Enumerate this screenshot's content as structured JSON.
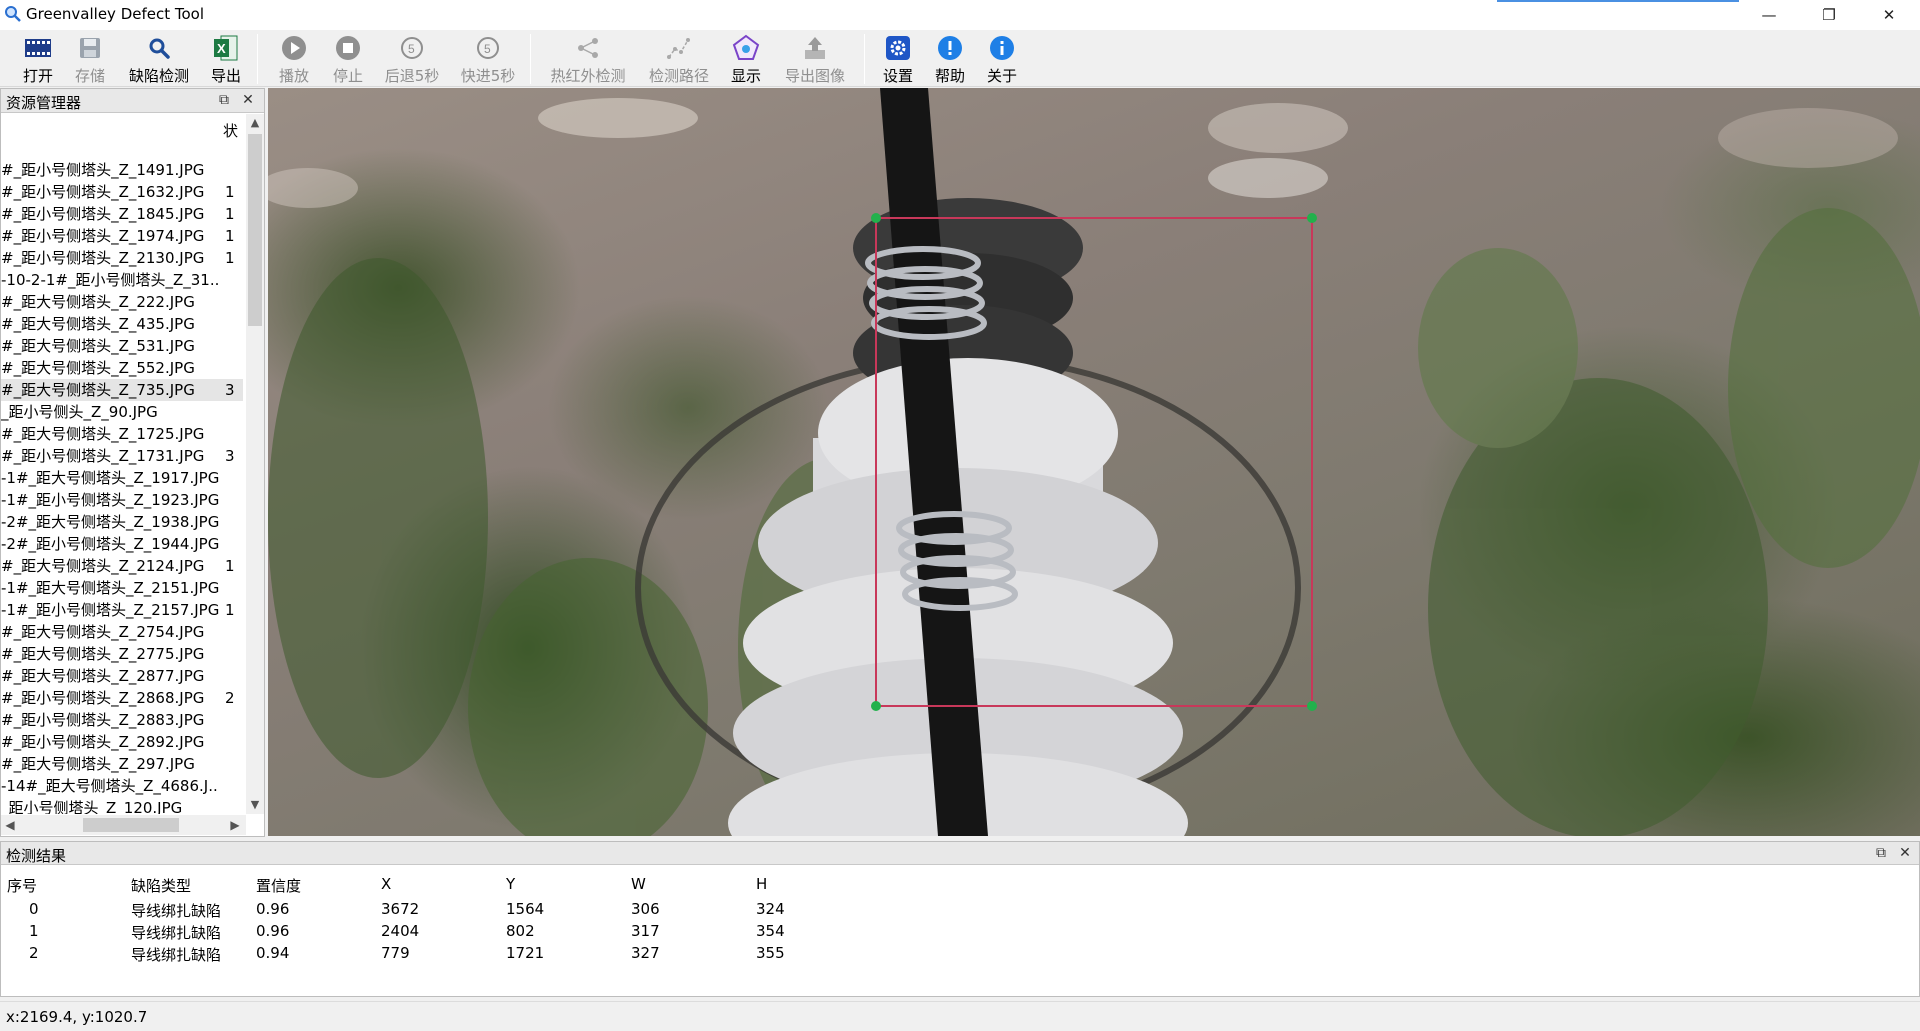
{
  "window": {
    "title": "Greenvalley Defect Tool",
    "minimize": "—",
    "restore": "❐",
    "close": "✕",
    "accent_color": "#4a90e2"
  },
  "toolbar": {
    "open": "打开",
    "save": "存储",
    "detect": "缺陷检测",
    "export": "导出",
    "play": "播放",
    "stop": "停止",
    "back5": "后退5秒",
    "fwd5": "快进5秒",
    "step_number": "5",
    "thermal": "热红外检测",
    "path": "检测路径",
    "display": "显示",
    "export_image": "导出图像",
    "settings": "设置",
    "help": "帮助",
    "about": "关于"
  },
  "explorer": {
    "title": "资源管理器",
    "status_column": "状",
    "files": [
      {
        "name": "#_距小号侧塔头_Z_1491.JPG",
        "status": ""
      },
      {
        "name": "#_距小号侧塔头_Z_1632.JPG",
        "status": "1"
      },
      {
        "name": "#_距小号侧塔头_Z_1845.JPG",
        "status": "1"
      },
      {
        "name": "#_距小号侧塔头_Z_1974.JPG",
        "status": "1"
      },
      {
        "name": "#_距小号侧塔头_Z_2130.JPG",
        "status": "1"
      },
      {
        "name": "-10-2-1#_距小号侧塔头_Z_31...",
        "status": ""
      },
      {
        "name": "#_距大号侧塔头_Z_222.JPG",
        "status": ""
      },
      {
        "name": "#_距大号侧塔头_Z_435.JPG",
        "status": ""
      },
      {
        "name": "#_距大号侧塔头_Z_531.JPG",
        "status": ""
      },
      {
        "name": "#_距大号侧塔头_Z_552.JPG",
        "status": ""
      },
      {
        "name": "#_距大号侧塔头_Z_735.JPG",
        "status": "3",
        "selected": true
      },
      {
        "name": "_距小号侧头_Z_90.JPG",
        "status": ""
      },
      {
        "name": "#_距大号侧塔头_Z_1725.JPG",
        "status": ""
      },
      {
        "name": "#_距小号侧塔头_Z_1731.JPG",
        "status": "3"
      },
      {
        "name": "-1#_距大号侧塔头_Z_1917.JPG",
        "status": ""
      },
      {
        "name": "-1#_距小号侧塔头_Z_1923.JPG",
        "status": ""
      },
      {
        "name": "-2#_距大号侧塔头_Z_1938.JPG",
        "status": ""
      },
      {
        "name": "-2#_距小号侧塔头_Z_1944.JPG",
        "status": ""
      },
      {
        "name": "#_距大号侧塔头_Z_2124.JPG",
        "status": "1"
      },
      {
        "name": "-1#_距大号侧塔头_Z_2151.JPG",
        "status": ""
      },
      {
        "name": "-1#_距小号侧塔头_Z_2157.JPG",
        "status": "1"
      },
      {
        "name": "#_距大号侧塔头_Z_2754.JPG",
        "status": ""
      },
      {
        "name": "#_距大号侧塔头_Z_2775.JPG",
        "status": ""
      },
      {
        "name": "#_距大号侧塔头_Z_2877.JPG",
        "status": ""
      },
      {
        "name": "#_距小号侧塔头_Z_2868.JPG",
        "status": "2"
      },
      {
        "name": "#_距小号侧塔头_Z_2883.JPG",
        "status": ""
      },
      {
        "name": "#_距小号侧塔头_Z_2892.JPG",
        "status": ""
      },
      {
        "name": "#_距大号侧塔头_Z_297.JPG",
        "status": ""
      },
      {
        "name": "-14#_距大号侧塔头_Z_4686.J...",
        "status": ""
      },
      {
        "name": "_距小号侧塔头_Z_120.JPG",
        "status": ""
      }
    ]
  },
  "viewer": {
    "box_color": "#c8385a",
    "handle_color": "#22b14c"
  },
  "results": {
    "title": "检测结果",
    "columns": [
      "序号",
      "缺陷类型",
      "置信度",
      "X",
      "Y",
      "W",
      "H"
    ],
    "rows": [
      [
        "0",
        "导线绑扎缺陷",
        "0.96",
        "3672",
        "1564",
        "306",
        "324"
      ],
      [
        "1",
        "导线绑扎缺陷",
        "0.96",
        "2404",
        "802",
        "317",
        "354"
      ],
      [
        "2",
        "导线绑扎缺陷",
        "0.94",
        "779",
        "1721",
        "327",
        "355"
      ]
    ]
  },
  "status": {
    "coords": "x:2169.4, y:1020.7"
  }
}
